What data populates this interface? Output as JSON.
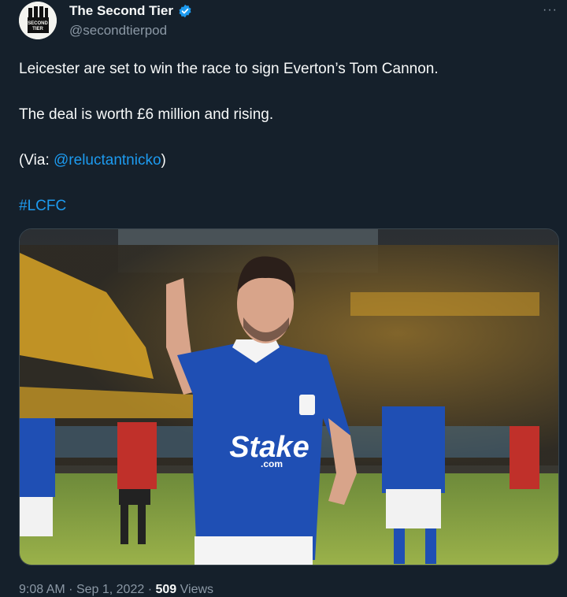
{
  "author": {
    "display_name": "The Second Tier",
    "handle": "@secondtierpod",
    "avatar_text_top": "SECOND",
    "avatar_text_bottom": "TIER",
    "verified": true
  },
  "more_label": "···",
  "tweet": {
    "line1": "Leicester are set to win the race to sign Everton’s Tom Cannon.",
    "line2": "The deal is worth £6 million and rising.",
    "via_prefix": "(Via: ",
    "via_mention": "@reluctantnicko",
    "via_suffix": ")",
    "hashtag": "#LCFC"
  },
  "media": {
    "alt": "Everton player in blue kit gesturing on pitch",
    "shirt_sponsor": "Stake",
    "shirt_sponsor_sub": ".com"
  },
  "footer": {
    "time": "9:08 AM",
    "separator": "·",
    "date": "Sep 1, 2022",
    "views_count": "509",
    "views_label": "Views"
  },
  "colors": {
    "background": "#15202b",
    "link": "#1d9bf0",
    "secondary_text": "#8b98a5",
    "everton_blue": "#1f4fb4"
  }
}
